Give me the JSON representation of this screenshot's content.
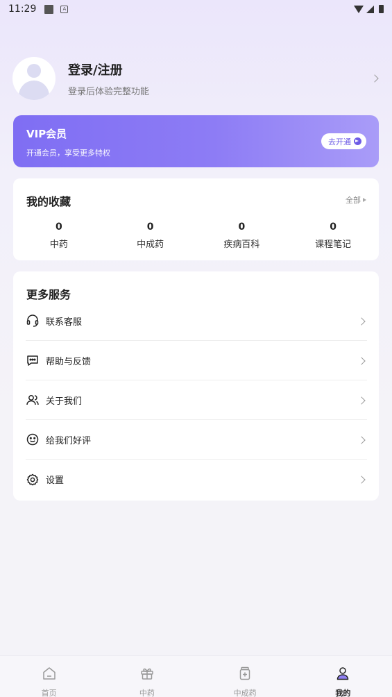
{
  "status_bar": {
    "time": "11:29"
  },
  "profile": {
    "title": "登录/注册",
    "subtitle": "登录后体验完整功能"
  },
  "vip": {
    "title": "VIP会员",
    "subtitle": "开通会员，享受更多特权",
    "button": "去开通"
  },
  "favorites": {
    "title": "我的收藏",
    "all_label": "全部",
    "items": [
      {
        "value": "0",
        "label": "中药"
      },
      {
        "value": "0",
        "label": "中成药"
      },
      {
        "value": "0",
        "label": "疾病百科"
      },
      {
        "value": "0",
        "label": "课程笔记"
      }
    ]
  },
  "services": {
    "title": "更多服务",
    "items": [
      {
        "label": "联系客服",
        "icon": "headset-icon"
      },
      {
        "label": "帮助与反馈",
        "icon": "chat-bubble-icon"
      },
      {
        "label": "关于我们",
        "icon": "users-icon"
      },
      {
        "label": "给我们好评",
        "icon": "smiley-icon"
      },
      {
        "label": "设置",
        "icon": "gear-icon"
      }
    ]
  },
  "tabbar": {
    "active_color": "#222222",
    "items": [
      {
        "label": "首页",
        "icon": "home-icon"
      },
      {
        "label": "中药",
        "icon": "gift-box-icon"
      },
      {
        "label": "中成药",
        "icon": "medicine-bottle-icon"
      },
      {
        "label": "我的",
        "icon": "user-icon"
      }
    ]
  }
}
